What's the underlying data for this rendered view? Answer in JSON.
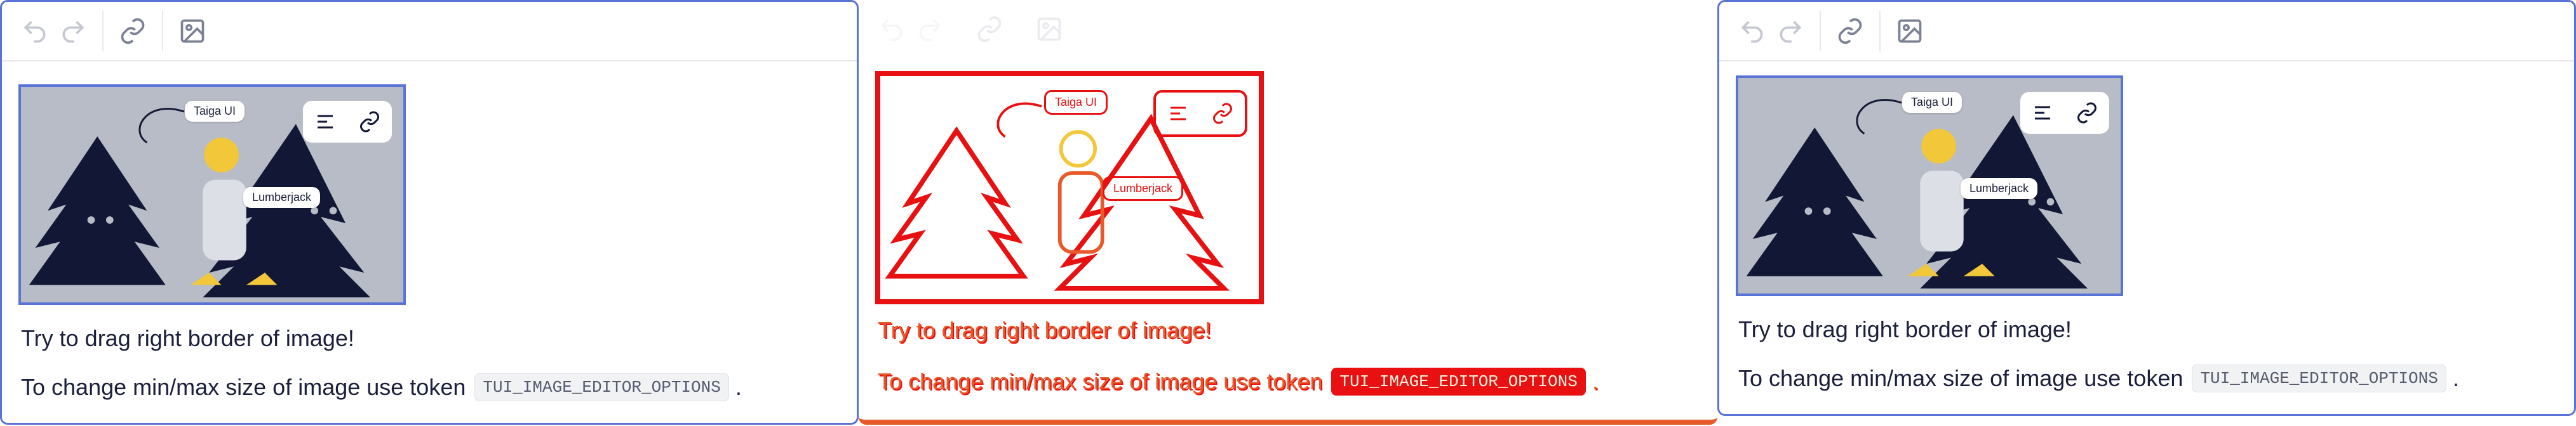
{
  "toolbar": {
    "undo_icon": "undo-icon",
    "redo_icon": "redo-icon",
    "link_icon": "link-icon",
    "image_icon": "image-icon"
  },
  "image": {
    "bubble_top": "Taiga UI",
    "bubble_bottom": "Lumberjack",
    "toolbar_icons": [
      "align-icon",
      "link-icon"
    ]
  },
  "content": {
    "line1": "Try to drag right border of image!",
    "line2_prefix": "To change min/max size of image use token",
    "token": "TUI_IMAGE_EDITOR_OPTIONS",
    "line2_suffix": "."
  },
  "colors": {
    "accent": "#5a73d6",
    "diff_red": "#e81010",
    "diff_orange": "#e85a2a",
    "image_bg": "#b7bcc6"
  }
}
